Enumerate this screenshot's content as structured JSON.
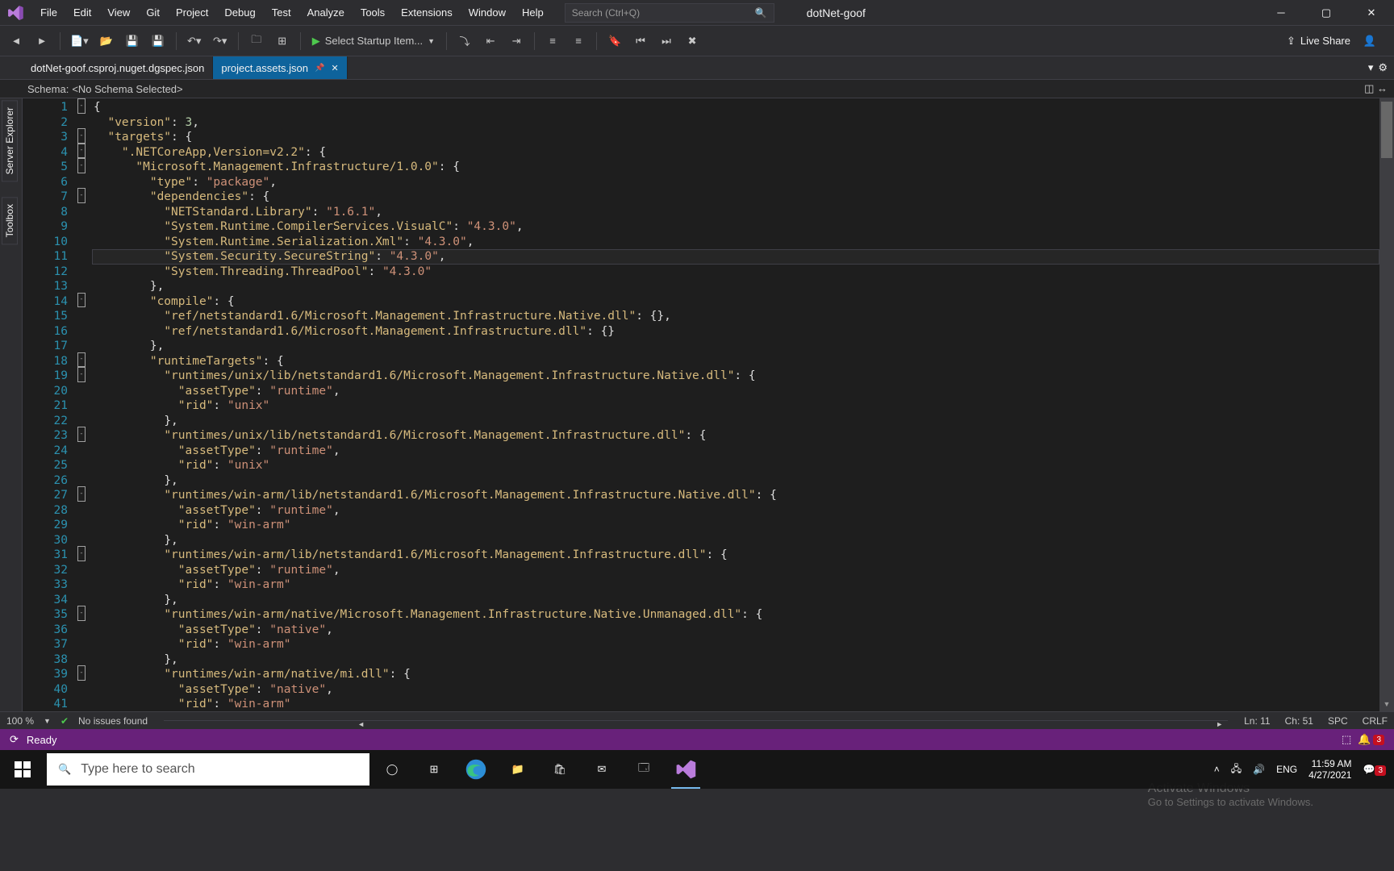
{
  "menu": [
    "File",
    "Edit",
    "View",
    "Git",
    "Project",
    "Debug",
    "Test",
    "Analyze",
    "Tools",
    "Extensions",
    "Window",
    "Help"
  ],
  "search_placeholder": "Search (Ctrl+Q)",
  "solution_name": "dotNet-goof",
  "start_label": "Select Startup Item...",
  "live_share": "Live Share",
  "tabs": [
    {
      "label": "dotNet-goof.csproj.nuget.dgspec.json",
      "active": false
    },
    {
      "label": "project.assets.json",
      "active": true
    }
  ],
  "schema_label": "Schema:",
  "schema_value": "<No Schema Selected>",
  "vtabs": [
    "Server Explorer",
    "Toolbox"
  ],
  "zoom": "100 %",
  "issues": "No issues found",
  "caret": {
    "ln": "Ln: 11",
    "ch": "Ch: 51",
    "spc": "SPC",
    "crlf": "CRLF"
  },
  "status": "Ready",
  "notif_count": "3",
  "lang": "ENG",
  "time": "11:59 AM",
  "date": "4/27/2021",
  "taskbar_search": "Type here to search",
  "activate": {
    "t1": "Activate Windows",
    "t2": "Go to Settings to activate Windows."
  },
  "code_lines": [
    {
      "n": 1,
      "fold": true,
      "i": 0,
      "txt": [
        [
          "d",
          "{"
        ]
      ]
    },
    {
      "n": 2,
      "i": 1,
      "txt": [
        [
          "k",
          "\"version\""
        ],
        [
          "d",
          ": "
        ],
        [
          "n",
          "3"
        ],
        [
          "d",
          ","
        ]
      ]
    },
    {
      "n": 3,
      "fold": true,
      "i": 1,
      "txt": [
        [
          "k",
          "\"targets\""
        ],
        [
          "d",
          ": {"
        ]
      ]
    },
    {
      "n": 4,
      "fold": true,
      "i": 2,
      "txt": [
        [
          "k",
          "\".NETCoreApp,Version=v2.2\""
        ],
        [
          "d",
          ": {"
        ]
      ]
    },
    {
      "n": 5,
      "fold": true,
      "i": 3,
      "txt": [
        [
          "k",
          "\"Microsoft.Management.Infrastructure/1.0.0\""
        ],
        [
          "d",
          ": {"
        ]
      ]
    },
    {
      "n": 6,
      "i": 4,
      "txt": [
        [
          "k",
          "\"type\""
        ],
        [
          "d",
          ": "
        ],
        [
          "s",
          "\"package\""
        ],
        [
          "d",
          ","
        ]
      ]
    },
    {
      "n": 7,
      "fold": true,
      "i": 4,
      "txt": [
        [
          "k",
          "\"dependencies\""
        ],
        [
          "d",
          ": {"
        ]
      ]
    },
    {
      "n": 8,
      "i": 5,
      "txt": [
        [
          "k",
          "\"NETStandard.Library\""
        ],
        [
          "d",
          ": "
        ],
        [
          "s",
          "\"1.6.1\""
        ],
        [
          "d",
          ","
        ]
      ]
    },
    {
      "n": 9,
      "i": 5,
      "txt": [
        [
          "k",
          "\"System.Runtime.CompilerServices.VisualC\""
        ],
        [
          "d",
          ": "
        ],
        [
          "s",
          "\"4.3.0\""
        ],
        [
          "d",
          ","
        ]
      ]
    },
    {
      "n": 10,
      "i": 5,
      "txt": [
        [
          "k",
          "\"System.Runtime.Serialization.Xml\""
        ],
        [
          "d",
          ": "
        ],
        [
          "s",
          "\"4.3.0\""
        ],
        [
          "d",
          ","
        ]
      ]
    },
    {
      "n": 11,
      "i": 5,
      "cur": true,
      "txt": [
        [
          "k",
          "\"System.Security.SecureString\""
        ],
        [
          "d",
          ": "
        ],
        [
          "s",
          "\"4.3.0\""
        ],
        [
          "d",
          ","
        ]
      ]
    },
    {
      "n": 12,
      "i": 5,
      "txt": [
        [
          "k",
          "\"System.Threading.ThreadPool\""
        ],
        [
          "d",
          ": "
        ],
        [
          "s",
          "\"4.3.0\""
        ]
      ]
    },
    {
      "n": 13,
      "i": 4,
      "txt": [
        [
          "d",
          "},"
        ]
      ]
    },
    {
      "n": 14,
      "fold": true,
      "i": 4,
      "txt": [
        [
          "k",
          "\"compile\""
        ],
        [
          "d",
          ": {"
        ]
      ]
    },
    {
      "n": 15,
      "i": 5,
      "txt": [
        [
          "k",
          "\"ref/netstandard1.6/Microsoft.Management.Infrastructure.Native.dll\""
        ],
        [
          "d",
          ": {},"
        ]
      ]
    },
    {
      "n": 16,
      "i": 5,
      "txt": [
        [
          "k",
          "\"ref/netstandard1.6/Microsoft.Management.Infrastructure.dll\""
        ],
        [
          "d",
          ": {}"
        ]
      ]
    },
    {
      "n": 17,
      "i": 4,
      "txt": [
        [
          "d",
          "},"
        ]
      ]
    },
    {
      "n": 18,
      "fold": true,
      "i": 4,
      "txt": [
        [
          "k",
          "\"runtimeTargets\""
        ],
        [
          "d",
          ": {"
        ]
      ]
    },
    {
      "n": 19,
      "fold": true,
      "i": 5,
      "txt": [
        [
          "k",
          "\"runtimes/unix/lib/netstandard1.6/Microsoft.Management.Infrastructure.Native.dll\""
        ],
        [
          "d",
          ": {"
        ]
      ]
    },
    {
      "n": 20,
      "i": 6,
      "txt": [
        [
          "k",
          "\"assetType\""
        ],
        [
          "d",
          ": "
        ],
        [
          "s",
          "\"runtime\""
        ],
        [
          "d",
          ","
        ]
      ]
    },
    {
      "n": 21,
      "i": 6,
      "txt": [
        [
          "k",
          "\"rid\""
        ],
        [
          "d",
          ": "
        ],
        [
          "s",
          "\"unix\""
        ]
      ]
    },
    {
      "n": 22,
      "i": 5,
      "txt": [
        [
          "d",
          "},"
        ]
      ]
    },
    {
      "n": 23,
      "fold": true,
      "i": 5,
      "txt": [
        [
          "k",
          "\"runtimes/unix/lib/netstandard1.6/Microsoft.Management.Infrastructure.dll\""
        ],
        [
          "d",
          ": {"
        ]
      ]
    },
    {
      "n": 24,
      "i": 6,
      "txt": [
        [
          "k",
          "\"assetType\""
        ],
        [
          "d",
          ": "
        ],
        [
          "s",
          "\"runtime\""
        ],
        [
          "d",
          ","
        ]
      ]
    },
    {
      "n": 25,
      "i": 6,
      "txt": [
        [
          "k",
          "\"rid\""
        ],
        [
          "d",
          ": "
        ],
        [
          "s",
          "\"unix\""
        ]
      ]
    },
    {
      "n": 26,
      "i": 5,
      "txt": [
        [
          "d",
          "},"
        ]
      ]
    },
    {
      "n": 27,
      "fold": true,
      "i": 5,
      "txt": [
        [
          "k",
          "\"runtimes/win-arm/lib/netstandard1.6/Microsoft.Management.Infrastructure.Native.dll\""
        ],
        [
          "d",
          ": {"
        ]
      ]
    },
    {
      "n": 28,
      "i": 6,
      "txt": [
        [
          "k",
          "\"assetType\""
        ],
        [
          "d",
          ": "
        ],
        [
          "s",
          "\"runtime\""
        ],
        [
          "d",
          ","
        ]
      ]
    },
    {
      "n": 29,
      "i": 6,
      "txt": [
        [
          "k",
          "\"rid\""
        ],
        [
          "d",
          ": "
        ],
        [
          "s",
          "\"win-arm\""
        ]
      ]
    },
    {
      "n": 30,
      "i": 5,
      "txt": [
        [
          "d",
          "},"
        ]
      ]
    },
    {
      "n": 31,
      "fold": true,
      "i": 5,
      "txt": [
        [
          "k",
          "\"runtimes/win-arm/lib/netstandard1.6/Microsoft.Management.Infrastructure.dll\""
        ],
        [
          "d",
          ": {"
        ]
      ]
    },
    {
      "n": 32,
      "i": 6,
      "txt": [
        [
          "k",
          "\"assetType\""
        ],
        [
          "d",
          ": "
        ],
        [
          "s",
          "\"runtime\""
        ],
        [
          "d",
          ","
        ]
      ]
    },
    {
      "n": 33,
      "i": 6,
      "txt": [
        [
          "k",
          "\"rid\""
        ],
        [
          "d",
          ": "
        ],
        [
          "s",
          "\"win-arm\""
        ]
      ]
    },
    {
      "n": 34,
      "i": 5,
      "txt": [
        [
          "d",
          "},"
        ]
      ]
    },
    {
      "n": 35,
      "fold": true,
      "i": 5,
      "txt": [
        [
          "k",
          "\"runtimes/win-arm/native/Microsoft.Management.Infrastructure.Native.Unmanaged.dll\""
        ],
        [
          "d",
          ": {"
        ]
      ]
    },
    {
      "n": 36,
      "i": 6,
      "txt": [
        [
          "k",
          "\"assetType\""
        ],
        [
          "d",
          ": "
        ],
        [
          "s",
          "\"native\""
        ],
        [
          "d",
          ","
        ]
      ]
    },
    {
      "n": 37,
      "i": 6,
      "txt": [
        [
          "k",
          "\"rid\""
        ],
        [
          "d",
          ": "
        ],
        [
          "s",
          "\"win-arm\""
        ]
      ]
    },
    {
      "n": 38,
      "i": 5,
      "txt": [
        [
          "d",
          "},"
        ]
      ]
    },
    {
      "n": 39,
      "fold": true,
      "i": 5,
      "txt": [
        [
          "k",
          "\"runtimes/win-arm/native/mi.dll\""
        ],
        [
          "d",
          ": {"
        ]
      ]
    },
    {
      "n": 40,
      "i": 6,
      "txt": [
        [
          "k",
          "\"assetType\""
        ],
        [
          "d",
          ": "
        ],
        [
          "s",
          "\"native\""
        ],
        [
          "d",
          ","
        ]
      ]
    },
    {
      "n": 41,
      "i": 6,
      "txt": [
        [
          "k",
          "\"rid\""
        ],
        [
          "d",
          ": "
        ],
        [
          "s",
          "\"win-arm\""
        ]
      ]
    }
  ]
}
